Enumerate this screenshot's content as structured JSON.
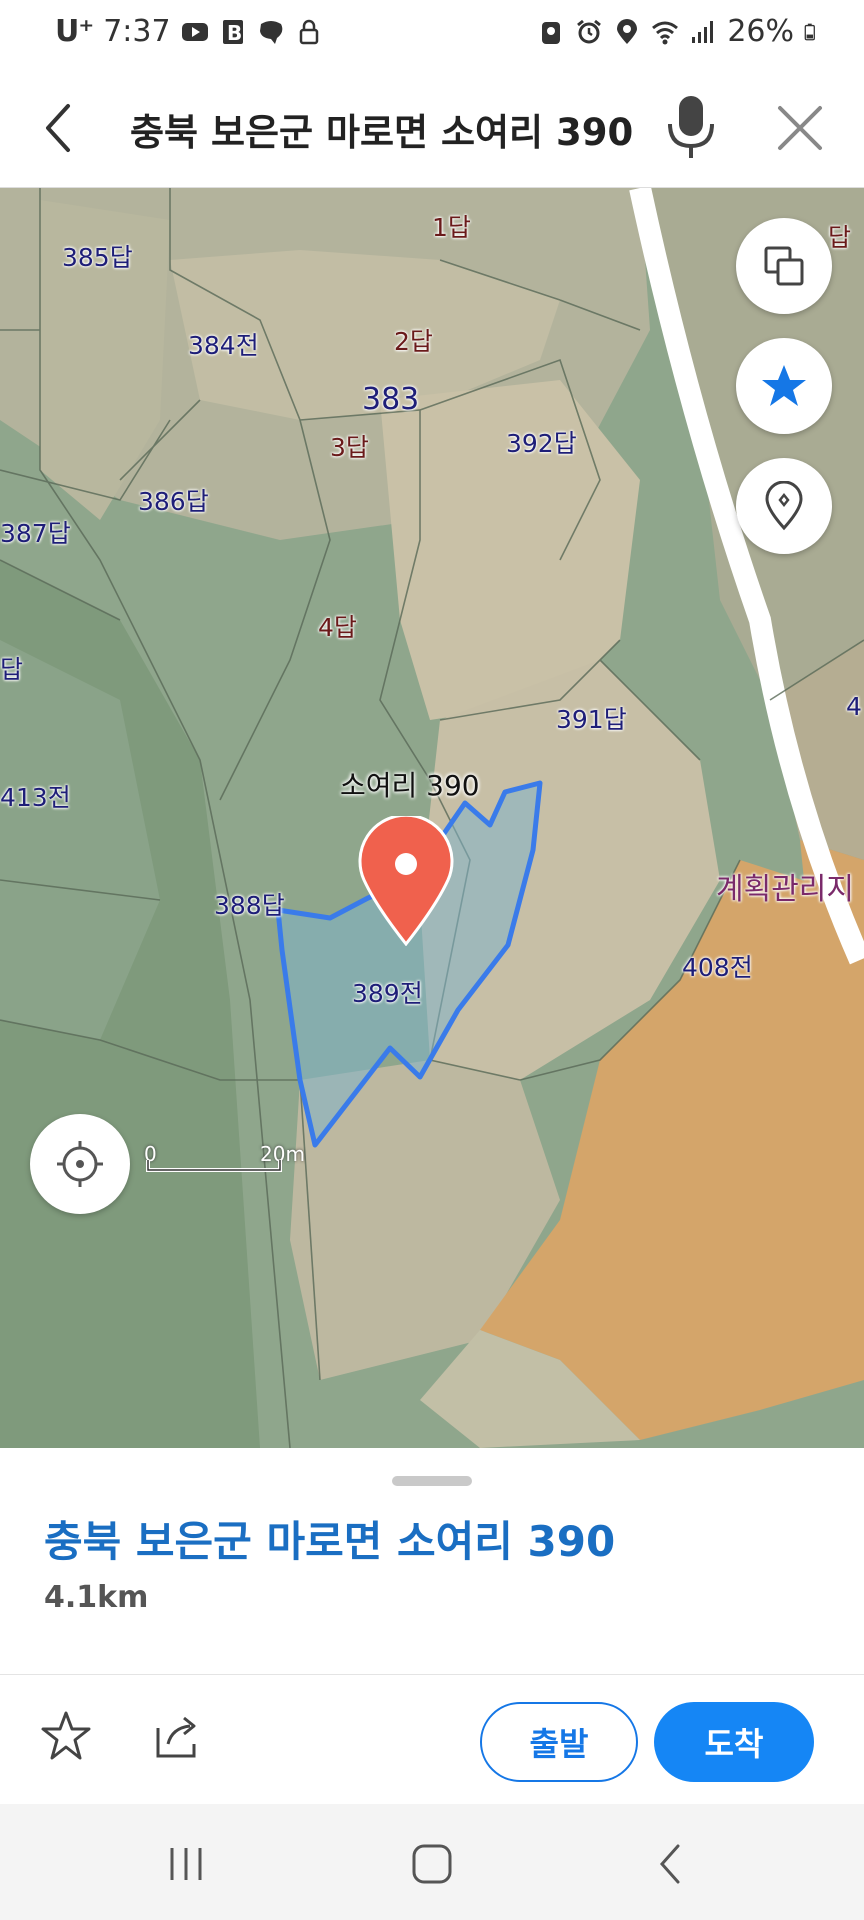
{
  "status_bar": {
    "carrier": "U⁺",
    "time": "7:37",
    "battery": "26%"
  },
  "search": {
    "query": "충북 보은군 마로면 소여리 390"
  },
  "map": {
    "parcels": [
      {
        "id": "p385",
        "text": "385답",
        "style": "blue"
      },
      {
        "id": "p1",
        "text": "1답",
        "style": "red"
      },
      {
        "id": "p384",
        "text": "384전",
        "style": "blue"
      },
      {
        "id": "p2",
        "text": "2답",
        "style": "red"
      },
      {
        "id": "p383",
        "text": "383",
        "style": "big"
      },
      {
        "id": "p3",
        "text": "3답",
        "style": "red"
      },
      {
        "id": "p392",
        "text": "392답",
        "style": "blue"
      },
      {
        "id": "p386",
        "text": "386답",
        "style": "blue"
      },
      {
        "id": "p387",
        "text": "387답",
        "style": "blue"
      },
      {
        "id": "p4",
        "text": "4답",
        "style": "red"
      },
      {
        "id": "p391",
        "text": "391답",
        "style": "blue"
      },
      {
        "id": "p413",
        "text": "413전",
        "style": "blue"
      },
      {
        "id": "p388",
        "text": "388답",
        "style": "blue"
      },
      {
        "id": "p389",
        "text": "389전",
        "style": "blue"
      },
      {
        "id": "p408",
        "text": "408전",
        "style": "blue"
      },
      {
        "id": "pleft",
        "text": "답",
        "style": "blue"
      },
      {
        "id": "pright4",
        "text": "4",
        "style": "blue"
      },
      {
        "id": "pright_top",
        "text": "답",
        "style": "red"
      }
    ],
    "zone_label": "계획관리지",
    "selected_parcel_label": "소여리 390",
    "scale": {
      "zero": "0",
      "distance": "20m"
    },
    "colors": {
      "selection_outline": "#3a7bea",
      "pin": "#f0614d",
      "zone_fill": "#d4a56a"
    }
  },
  "sheet": {
    "title": "충북 보은군 마로면 소여리 390",
    "distance": "4.1km",
    "depart_label": "출발",
    "arrive_label": "도착"
  }
}
